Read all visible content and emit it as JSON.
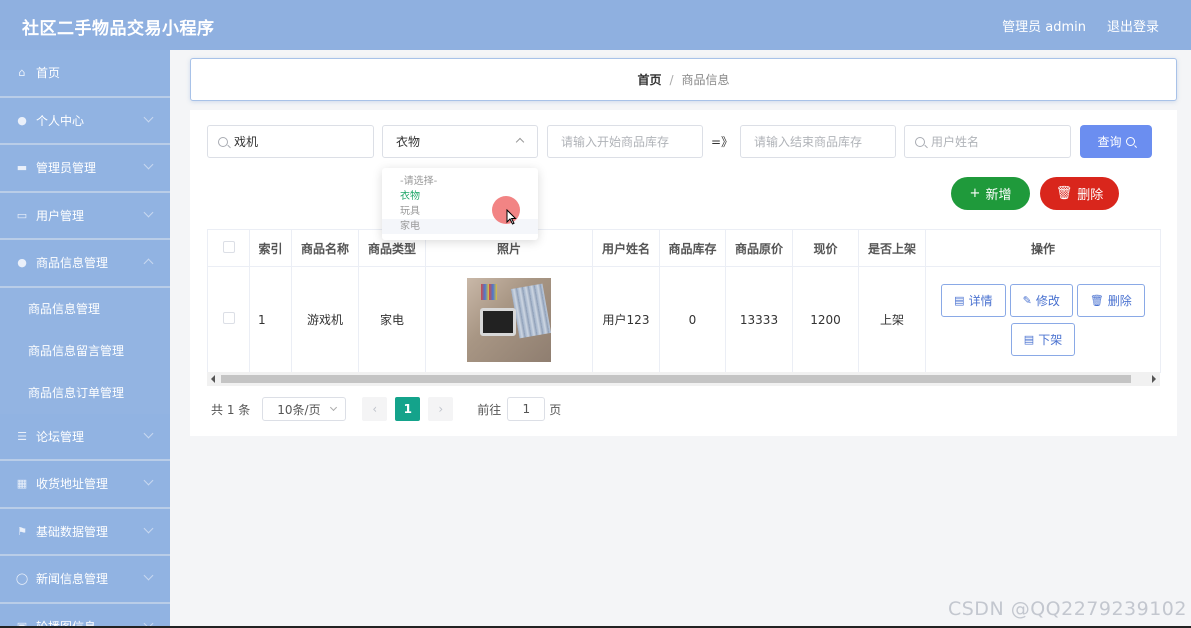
{
  "header": {
    "title": "社区二手物品交易小程序",
    "user": "管理员 admin",
    "logout": "退出登录"
  },
  "sidebar": {
    "items": [
      {
        "label": "首页",
        "icon": "home-icon",
        "glyph": "⌂"
      },
      {
        "label": "个人中心",
        "icon": "user-icon",
        "glyph": "●"
      },
      {
        "label": "管理员管理",
        "icon": "briefcase-icon",
        "glyph": "▬"
      },
      {
        "label": "用户管理",
        "icon": "id-card-icon",
        "glyph": "▭"
      },
      {
        "label": "商品信息管理",
        "icon": "user-icon",
        "glyph": "●"
      },
      {
        "label": "论坛管理",
        "icon": "list-icon",
        "glyph": "☰"
      },
      {
        "label": "收货地址管理",
        "icon": "grid-icon",
        "glyph": "▦"
      },
      {
        "label": "基础数据管理",
        "icon": "flag-icon",
        "glyph": "⚑"
      },
      {
        "label": "新闻信息管理",
        "icon": "power-icon",
        "glyph": "◯"
      },
      {
        "label": "轮播图信息",
        "icon": "image-icon",
        "glyph": "▣"
      }
    ],
    "subitems": [
      "商品信息管理",
      "商品信息留言管理",
      "商品信息订单管理"
    ]
  },
  "breadcrumb": {
    "home": "首页",
    "sep": "/",
    "current": "商品信息"
  },
  "search": {
    "name_value": "戏机",
    "type_value": "衣物",
    "stock_start_placeholder": "请输入开始商品库存",
    "arrow": "=》",
    "stock_end_placeholder": "请输入结束商品库存",
    "username_placeholder": "用户姓名",
    "query_label": "查询"
  },
  "dropdown": {
    "options": [
      "-请选择-",
      "衣物",
      "玩具",
      "家电"
    ]
  },
  "actions": {
    "add_label": "新增",
    "delete_label": "删除"
  },
  "table": {
    "headers": [
      "索引",
      "商品名称",
      "商品类型",
      "照片",
      "用户姓名",
      "商品库存",
      "商品原价",
      "现价",
      "是否上架",
      "操作"
    ],
    "rows": [
      {
        "index": "1",
        "name": "游戏机",
        "type": "家电",
        "user": "用户123",
        "stock": "0",
        "orig_price": "13333",
        "price": "1200",
        "onsale": "上架"
      }
    ],
    "ops": {
      "detail": "详情",
      "edit": "修改",
      "delete": "删除",
      "offshelf": "下架"
    }
  },
  "pager": {
    "total": "共 1 条",
    "size": "10条/页",
    "prev": "‹",
    "page": "1",
    "next": "›",
    "goto": "前往",
    "goto_value": "1",
    "page_unit": "页"
  },
  "watermark": "CSDN @QQ2279239102"
}
